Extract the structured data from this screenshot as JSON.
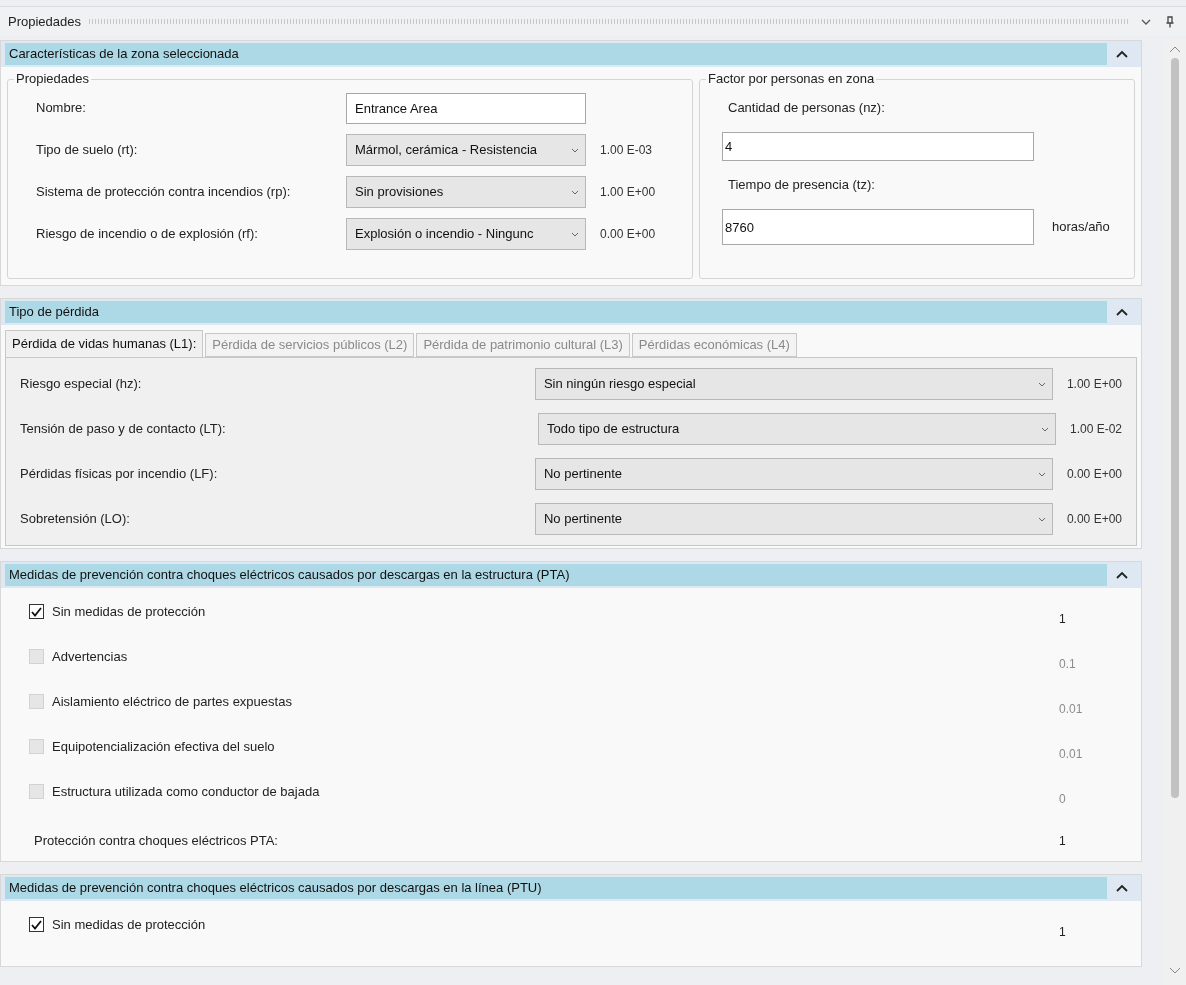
{
  "panel": {
    "title": "Propiedades"
  },
  "sections": [
    {
      "kind": "zone",
      "title": "Características de la zona seleccionada",
      "expanded": true,
      "properties": {
        "legend": "Propiedades",
        "rows": [
          {
            "kind": "text",
            "label": "Nombre:",
            "value": "Entrance Area"
          },
          {
            "kind": "select",
            "label": "Tipo de suelo (rt):",
            "value": "Mármol, cerámica - Resistencia",
            "factor": "1.00 E-03"
          },
          {
            "kind": "select",
            "label": "Sistema de protección contra incendios (rp):",
            "value": "Sin provisiones",
            "factor": "1.00 E+00"
          },
          {
            "kind": "select",
            "label": "Riesgo de incendio o de explosión (rf):",
            "value": "Explosión o incendio - Ningunc",
            "factor": "0.00 E+00"
          }
        ]
      },
      "persons": {
        "legend": "Factor por personas en zona",
        "fields": [
          {
            "label": "Cantidad de personas (nz):",
            "value": "4"
          },
          {
            "label": "Tiempo de presencia (tz):",
            "value": "8760",
            "unit": "horas/año"
          }
        ]
      }
    },
    {
      "kind": "loss",
      "title": "Tipo de pérdida",
      "expanded": true,
      "tabs": [
        {
          "label": "Pérdida de vidas humanas (L1):",
          "selected": true
        },
        {
          "label": "Pérdida de servicios públicos (L2)",
          "selected": false
        },
        {
          "label": "Pérdida de patrimonio cultural (L3)",
          "selected": false
        },
        {
          "label": "Pérdidas económicas (L4)",
          "selected": false
        }
      ],
      "rows": [
        {
          "label": "Riesgo especial (hz):",
          "value": "Sin ningún riesgo especial",
          "factor": "1.00 E+00"
        },
        {
          "label": "Tensión de paso y de contacto (LT):",
          "value": "Todo tipo de estructura",
          "factor": "1.00 E-02"
        },
        {
          "label": "Pérdidas físicas por incendio (LF):",
          "value": "No pertinente",
          "factor": "0.00 E+00"
        },
        {
          "label": "Sobretensión (LO):",
          "value": "No pertinente",
          "factor": "0.00 E+00"
        }
      ]
    },
    {
      "kind": "measures",
      "title": "Medidas de prevención contra choques eléctricos causados por descargas en la estructura (PTA)",
      "expanded": true,
      "items": [
        {
          "label": "Sin medidas de protección",
          "checked": true,
          "disabled": false,
          "value": "1"
        },
        {
          "label": "Advertencias",
          "checked": false,
          "disabled": true,
          "value": "0.1"
        },
        {
          "label": "Aislamiento eléctrico de partes expuestas",
          "checked": false,
          "disabled": true,
          "value": "0.01"
        },
        {
          "label": "Equipotencialización efectiva del suelo",
          "checked": false,
          "disabled": true,
          "value": "0.01"
        },
        {
          "label": "Estructura utilizada como conductor de bajada",
          "checked": false,
          "disabled": true,
          "value": "0"
        }
      ],
      "summary": {
        "label": "Protección contra choques eléctricos PTA:",
        "value": "1"
      }
    },
    {
      "kind": "measures",
      "title": "Medidas de prevención contra choques eléctricos causados por descargas en la línea (PTU)",
      "expanded": true,
      "items": [
        {
          "label": "Sin medidas de protección",
          "checked": true,
          "disabled": false,
          "value": "1"
        }
      ]
    }
  ]
}
